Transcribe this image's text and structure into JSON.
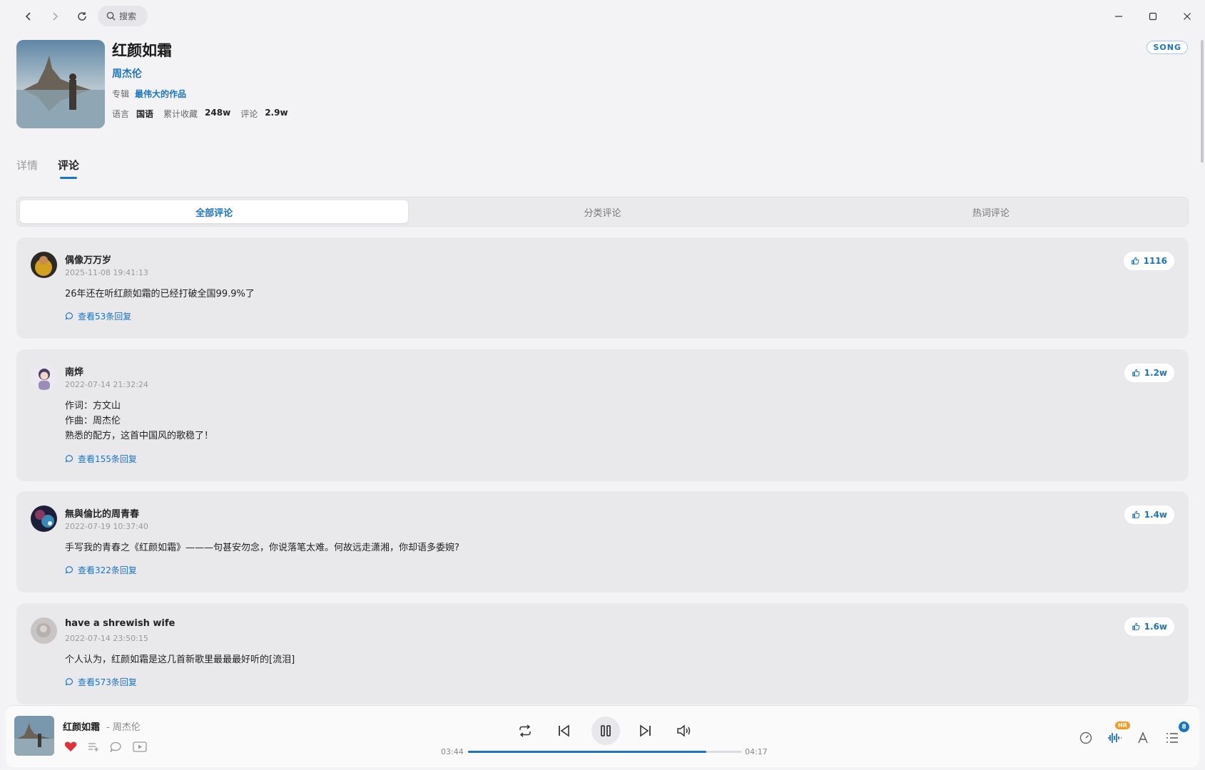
{
  "topbar": {
    "search_placeholder": "搜索"
  },
  "song": {
    "title": "红颜如霜",
    "artist": "周杰伦",
    "album_label": "专辑",
    "album": "最伟大的作品",
    "language_label": "语言",
    "language": "国语",
    "favorites_label": "累计收藏",
    "favorites": "248w",
    "comments_label": "评论",
    "comments": "2.9w",
    "badge": "SONG"
  },
  "tabs": [
    {
      "label": "详情"
    },
    {
      "label": "评论"
    }
  ],
  "segments": [
    {
      "label": "全部评论"
    },
    {
      "label": "分类评论"
    },
    {
      "label": "热词评论"
    }
  ],
  "comments": [
    {
      "user": "偶像万万岁",
      "time": "2025-11-08 19:41:13",
      "lines": [
        "26年还在听红颜如霜的已经打破全国99.9%了"
      ],
      "replies": "查看53条回复",
      "likes": "1116"
    },
    {
      "user": "南烨",
      "time": "2022-07-14 21:32:24",
      "lines": [
        "作词：方文山",
        "作曲：周杰伦",
        "熟悉的配方，这首中国风的歌稳了！"
      ],
      "replies": "查看155条回复",
      "likes": "1.2w"
    },
    {
      "user": "無與倫比的周青春",
      "time": "2022-07-19 10:37:40",
      "lines": [
        "手写我的青春之《红颜如霜》———句甚安勿念，你说落笔太难。何故远走潇湘，你却语多委婉?"
      ],
      "replies": "查看322条回复",
      "likes": "1.4w"
    },
    {
      "user": "have a shrewish wife",
      "time": "2022-07-14 23:50:15",
      "lines": [
        "个人认为，红颜如霜是这几首新歌里最最最好听的[流泪]"
      ],
      "replies": "查看573条回复",
      "likes": "1.6w"
    }
  ],
  "player": {
    "title": "红颜如霜",
    "separator": "-",
    "artist": "周杰伦",
    "current_time": "03:44",
    "total_time": "04:17",
    "progress": 0.87,
    "hr_badge": "HR",
    "queue_count": "8"
  },
  "colors": {
    "accent": "#1a74c4",
    "background": "#f3f3f5",
    "card": "#e9e9ec",
    "heart": "#e0303a"
  }
}
